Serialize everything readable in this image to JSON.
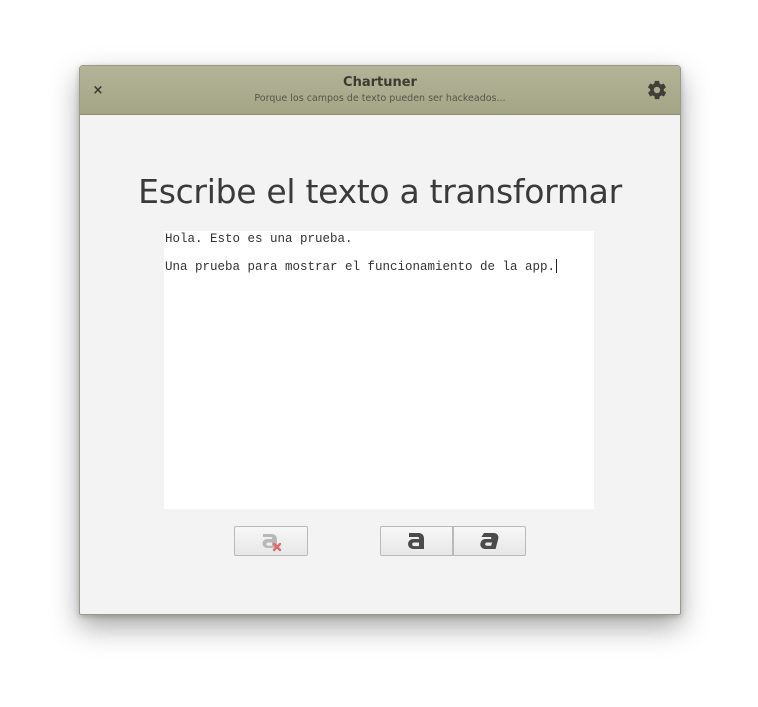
{
  "window": {
    "title": "Chartuner",
    "subtitle": "Porque los campos de texto pueden ser hackeados...",
    "close_label": "×"
  },
  "main": {
    "heading": "Escribe el texto a transformar",
    "text_lines": [
      "Hola. Esto es una prueba.",
      "",
      "Una prueba para mostrar el funcionamiento de la app."
    ]
  },
  "icons": {
    "close": "close-icon",
    "settings": "gear-icon",
    "clear": "clear-format-icon",
    "font_a": "font-a-normal-icon",
    "font_b": "font-a-italic-icon"
  },
  "colors": {
    "titlebar": "#a9aa8c",
    "window_bg": "#f3f3f3",
    "clear_accent": "#e06a6a"
  }
}
